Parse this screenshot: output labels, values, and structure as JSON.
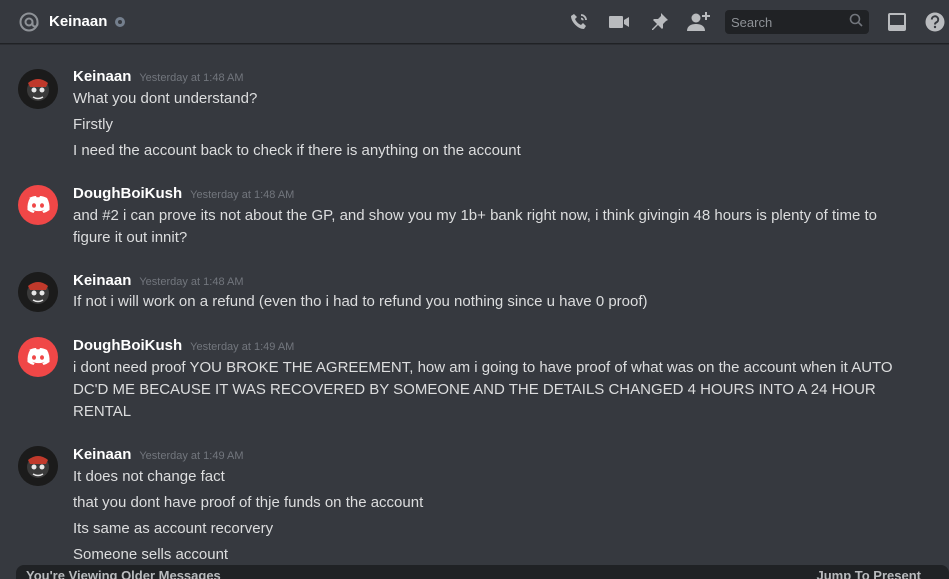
{
  "header": {
    "channel_name": "Keinaan",
    "search_placeholder": "Search"
  },
  "messages": [
    {
      "author": "Keinaan",
      "timestamp": "Yesterday at 1:48 AM",
      "avatar": "keinaan-avatar",
      "lines": [
        "What you dont understand?",
        "Firstly",
        "I need the account back to check if there is anything on the account"
      ]
    },
    {
      "author": "DoughBoiKush",
      "timestamp": "Yesterday at 1:48 AM",
      "avatar": "discord-default-avatar",
      "lines": [
        "and #2 i can prove its not about the GP, and show you my 1b+ bank right now, i think givingin 48 hours is plenty of time to figure it out innit?"
      ]
    },
    {
      "author": "Keinaan",
      "timestamp": "Yesterday at 1:48 AM",
      "avatar": "keinaan-avatar",
      "lines": [
        "If not i will work on a refund (even tho i had to refund you nothing since u have 0 proof)"
      ]
    },
    {
      "author": "DoughBoiKush",
      "timestamp": "Yesterday at 1:49 AM",
      "avatar": "discord-default-avatar",
      "lines": [
        "i dont need proof YOU BROKE THE AGREEMENT, how am i going to have proof of what was on the account when it AUTO DC'D ME BECAUSE IT WAS RECOVERED BY SOMEONE AND THE DETAILS CHANGED 4 HOURS INTO A 24 HOUR RENTAL"
      ]
    },
    {
      "author": "Keinaan",
      "timestamp": "Yesterday at 1:49 AM",
      "avatar": "keinaan-avatar",
      "lines": [
        "It does not change fact",
        "that you dont have proof of thje funds on the account",
        "Its same as account recorvery",
        "Someone sells account"
      ]
    }
  ],
  "footer": {
    "older_messages": "You're Viewing Older Messages",
    "jump_to_present": "Jump To Present"
  },
  "colors": {
    "background": "#36393f",
    "discord_red": "#f04747",
    "author": "#ffffff",
    "timestamp": "#72767d"
  }
}
